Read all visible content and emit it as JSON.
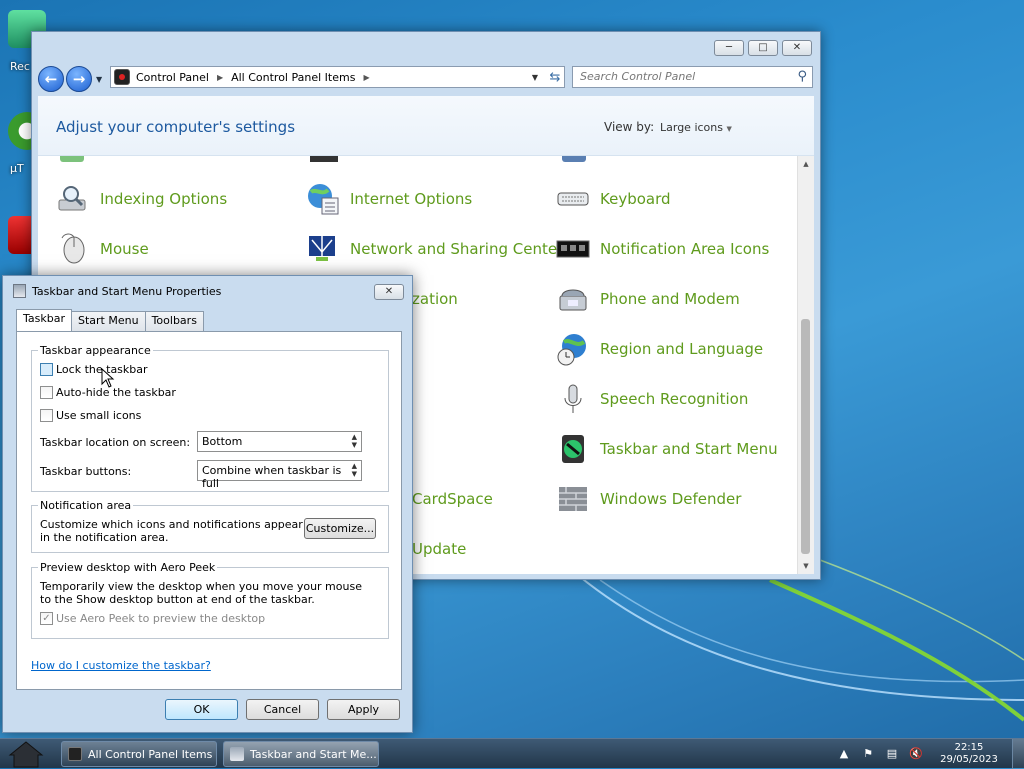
{
  "desktop": {
    "icons": [
      {
        "label": "Rec"
      },
      {
        "label": "µT"
      }
    ]
  },
  "control_panel": {
    "breadcrumb": [
      "Control Panel",
      "All Control Panel Items"
    ],
    "search_placeholder": "Search Control Panel",
    "heading": "Adjust your computer's settings",
    "view_by_label": "View by:",
    "view_by_value": "Large icons",
    "items": [
      {
        "name": "Indexing Options"
      },
      {
        "name": "Internet Options"
      },
      {
        "name": "Keyboard"
      },
      {
        "name": "Mouse"
      },
      {
        "name": "Network and Sharing Center"
      },
      {
        "name": "Notification Area Icons"
      },
      {
        "name": "zation"
      },
      {
        "name": "Phone and Modem"
      },
      {
        "name": "Region and Language"
      },
      {
        "name": "Speech Recognition"
      },
      {
        "name": "Taskbar and Start Menu"
      },
      {
        "name": "CardSpace"
      },
      {
        "name": "Windows Defender"
      },
      {
        "name": "Update"
      }
    ]
  },
  "dialog": {
    "title": "Taskbar and Start Menu Properties",
    "tabs": [
      "Taskbar",
      "Start Menu",
      "Toolbars"
    ],
    "appearance": {
      "title": "Taskbar appearance",
      "lock": "Lock the taskbar",
      "autohide": "Auto-hide the taskbar",
      "small_icons": "Use small icons",
      "location_label": "Taskbar location on screen:",
      "location_value": "Bottom",
      "buttons_label": "Taskbar buttons:",
      "buttons_value": "Combine when taskbar is full"
    },
    "notification": {
      "title": "Notification area",
      "text": "Customize which icons and notifications appear in the notification area.",
      "button": "Customize..."
    },
    "peek": {
      "title": "Preview desktop with Aero Peek",
      "text": "Temporarily view the desktop when you move your mouse to the Show desktop button at end of the taskbar.",
      "checkbox": "Use Aero Peek to preview the desktop"
    },
    "help_link": "How do I customize the taskbar?",
    "ok": "OK",
    "cancel": "Cancel",
    "apply": "Apply"
  },
  "taskbar": {
    "buttons": [
      "All Control Panel Items",
      "Taskbar and Start Me..."
    ],
    "time": "22:15",
    "date": "29/05/2023"
  }
}
